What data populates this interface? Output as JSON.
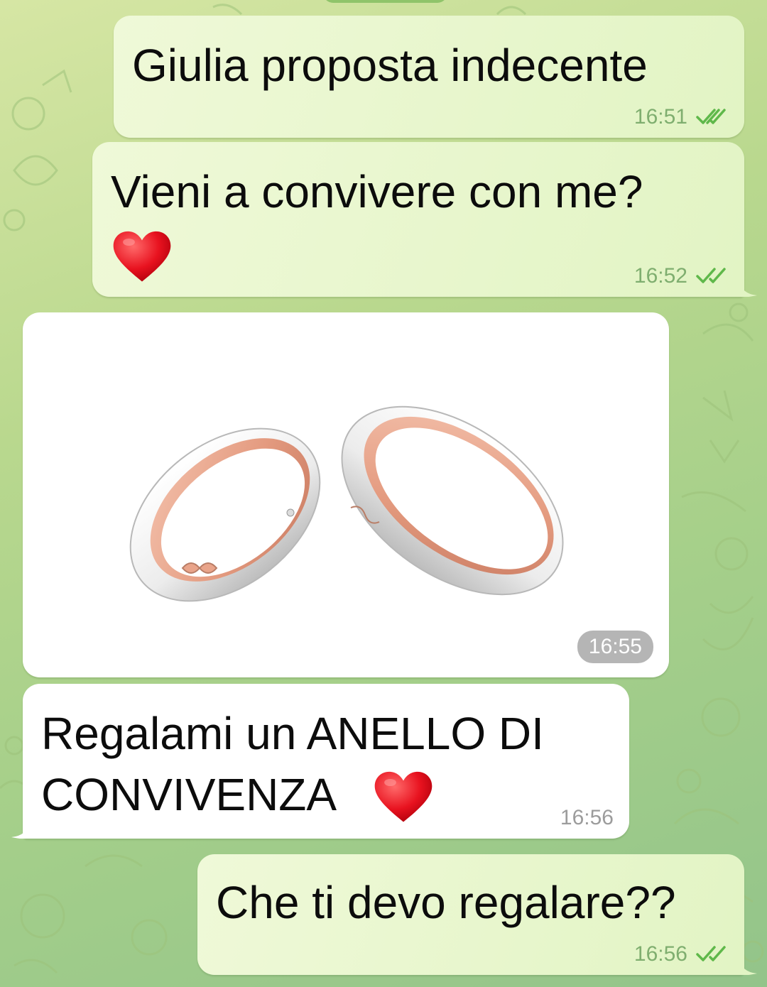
{
  "messages": [
    {
      "direction": "outgoing",
      "text": "Giulia proposta indecente",
      "time": "16:51",
      "status_icon": "double-check-icon"
    },
    {
      "direction": "outgoing",
      "text_line1": "Vieni a convivere con me?",
      "emoji": "red-heart-icon",
      "time": "16:52",
      "status_icon": "double-check-icon"
    },
    {
      "direction": "incoming",
      "type": "photo",
      "image": "wedding-rings-image",
      "time": "16:55"
    },
    {
      "direction": "incoming",
      "text_line1": "Regalami un ANELLO DI",
      "text_line2": "CONVIVENZA",
      "emoji": "red-heart-icon",
      "time": "16:56"
    },
    {
      "direction": "outgoing",
      "text": "Che ti devo regalare??",
      "time": "16:56",
      "status_icon": "double-check-icon"
    }
  ],
  "colors": {
    "outgoing_bubble": "#e2f4c4",
    "incoming_bubble": "#ffffff",
    "read_check": "#5fb84a",
    "rose_gold": "#e9a48a",
    "wallpaper": "#b9d88e"
  }
}
